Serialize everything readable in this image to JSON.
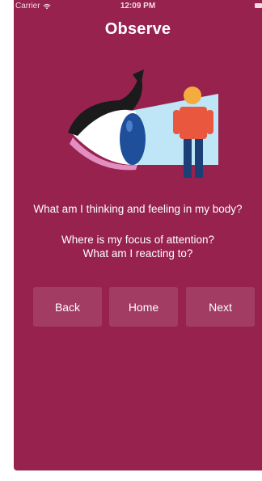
{
  "status_bar": {
    "carrier": "Carrier",
    "time": "12:09 PM"
  },
  "title": "Observe",
  "illustration": {
    "icon": "eye-observing-person-icon",
    "colors": {
      "eye_lash": "#1b1b1b",
      "iris": "#1f4f9a",
      "beam": "#bfe6f6",
      "shirt": "#e9573f",
      "head": "#f3ac3d",
      "pants": "#1d3f78",
      "lip": "#e28ec0"
    }
  },
  "questions": {
    "q1": "What am I thinking and feeling in my body?",
    "q2_line1": "Where is my focus of attention?",
    "q2_line2": "What am I reacting to?"
  },
  "buttons": {
    "back": "Back",
    "home": "Home",
    "next": "Next"
  },
  "colors": {
    "background": "#97224e",
    "text": "#ffffff"
  }
}
